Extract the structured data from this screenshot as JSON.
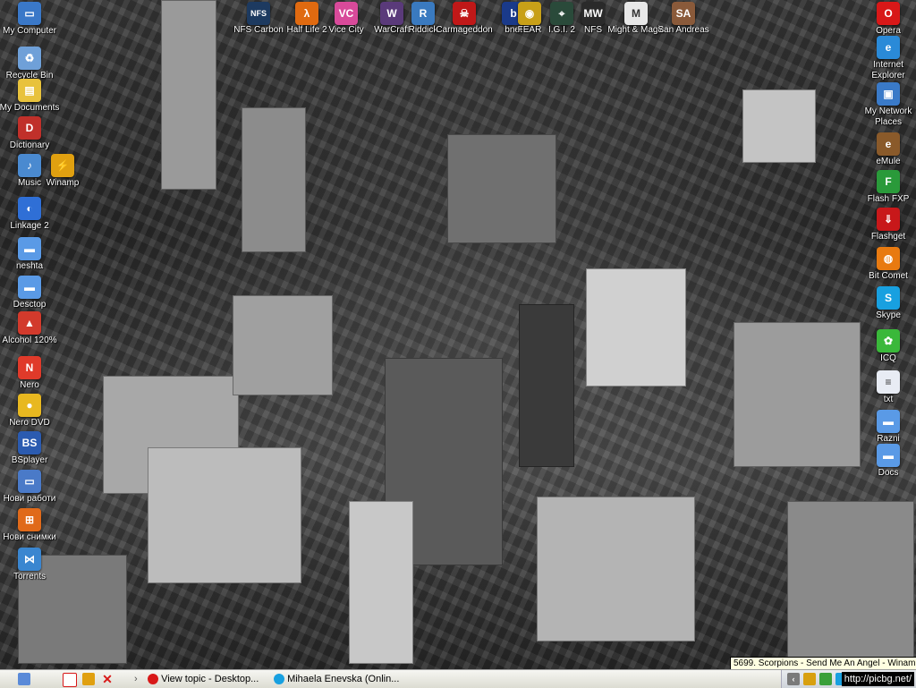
{
  "desktop": {
    "left_icons": [
      {
        "label": "My Computer",
        "icon": "computer-icon",
        "color": "#3a78c8",
        "glyph": "▭"
      },
      {
        "label": "Recycle Bin",
        "icon": "recycle-bin-icon",
        "color": "#6fa0d8",
        "glyph": "♻"
      },
      {
        "label": "My Documents",
        "icon": "documents-folder-icon",
        "color": "#e8c23c",
        "glyph": "▤"
      },
      {
        "label": "Dictionary",
        "icon": "dictionary-icon",
        "color": "#c0302a",
        "glyph": "D"
      },
      {
        "label": "Music",
        "icon": "music-icon",
        "color": "#4a8ad0",
        "glyph": "♪"
      },
      {
        "label": "Linkage 2",
        "icon": "linkage-icon",
        "color": "#2f6fd6",
        "glyph": "◐"
      },
      {
        "label": "neshta",
        "icon": "folder-icon",
        "color": "#5a9ae6",
        "glyph": "▬"
      },
      {
        "label": "Desctop",
        "icon": "folder-icon",
        "color": "#5a9ae6",
        "glyph": "▬"
      },
      {
        "label": "Alcohol 120%",
        "icon": "alcohol-icon",
        "color": "#d23a2c",
        "glyph": "▲"
      },
      {
        "label": "Nero",
        "icon": "nero-icon",
        "color": "#e03a2a",
        "glyph": "N"
      },
      {
        "label": "Nero DVD",
        "icon": "nero-dvd-icon",
        "color": "#e8b820",
        "glyph": "●"
      },
      {
        "label": "BSplayer",
        "icon": "bsplayer-icon",
        "color": "#2b5bb0",
        "glyph": "BS"
      },
      {
        "label": "Нови работи",
        "icon": "scanner-icon",
        "color": "#4a7ac8",
        "glyph": "▭"
      },
      {
        "label": "Нови снимки",
        "icon": "windows-flag-icon",
        "color": "#e06a1a",
        "glyph": "⊞"
      },
      {
        "label": "Torrents",
        "icon": "network-folder-icon",
        "color": "#3a86d0",
        "glyph": "⋈"
      }
    ],
    "winamp": {
      "label": "Winamp",
      "icon": "winamp-icon",
      "color": "#e0a010",
      "glyph": "⚡"
    },
    "top_icons": [
      {
        "label": "NFS Carbon",
        "icon": "nfs-carbon-icon",
        "color": "#1d3a60",
        "glyph": "NFS"
      },
      {
        "label": "Half Life 2",
        "icon": "half-life-icon",
        "color": "#e06a10",
        "glyph": "λ"
      },
      {
        "label": "Vice City",
        "icon": "vice-city-icon",
        "color": "#d84a9a",
        "glyph": "VC"
      },
      {
        "label": "WarCraft",
        "icon": "warcraft-icon",
        "color": "#5a3a7a",
        "glyph": "W"
      },
      {
        "label": "Riddick",
        "icon": "riddick-icon",
        "color": "#3a7ac0",
        "glyph": "R"
      },
      {
        "label": "Carmageddon",
        "icon": "carmageddon-icon",
        "color": "#c01818",
        "glyph": "☠"
      },
      {
        "label": "bnet",
        "icon": "bnet-icon",
        "color": "#1a3a8a",
        "glyph": "b"
      },
      {
        "label": "FEAR",
        "icon": "fear-icon",
        "color": "#c8a018",
        "glyph": "◉"
      },
      {
        "label": "I.G.I. 2",
        "icon": "igi-icon",
        "color": "#2a4a3a",
        "glyph": "⌖"
      },
      {
        "label": "NFS",
        "icon": "nfs-mw-icon",
        "color": "#2a2a2a",
        "glyph": "MW"
      },
      {
        "label": "Might & Magic",
        "icon": "might-magic-icon",
        "color": "#e8e8e8",
        "glyph": "M"
      },
      {
        "label": "San Andreas",
        "icon": "san-andreas-icon",
        "color": "#8a5a3a",
        "glyph": "SA"
      }
    ],
    "right_icons": [
      {
        "label": "Opera",
        "icon": "opera-icon",
        "color": "#d81818",
        "glyph": "O"
      },
      {
        "label": "Internet Explorer",
        "icon": "internet-explorer-icon",
        "color": "#2a8ad8",
        "glyph": "e"
      },
      {
        "label": "My Network Places",
        "icon": "network-places-icon",
        "color": "#3a7ac8",
        "glyph": "▣"
      },
      {
        "label": "eMule",
        "icon": "emule-icon",
        "color": "#8a5a2a",
        "glyph": "e"
      },
      {
        "label": "Flash FXP",
        "icon": "flashfxp-icon",
        "color": "#2a9a3a",
        "glyph": "F"
      },
      {
        "label": "Flashget",
        "icon": "flashget-icon",
        "color": "#c8181a",
        "glyph": "⇓"
      },
      {
        "label": "Bit Comet",
        "icon": "bitcomet-icon",
        "color": "#e87a10",
        "glyph": "◍"
      },
      {
        "label": "Skype",
        "icon": "skype-icon",
        "color": "#18a0e0",
        "glyph": "S"
      },
      {
        "label": "ICQ",
        "icon": "icq-icon",
        "color": "#3ab83a",
        "glyph": "✿"
      },
      {
        "label": "txt",
        "icon": "text-file-icon",
        "color": "#e8ecf4",
        "glyph": "≡"
      },
      {
        "label": "Razni",
        "icon": "folder-icon",
        "color": "#5a9ae6",
        "glyph": "▬"
      },
      {
        "label": "Docs",
        "icon": "folder-icon",
        "color": "#5a9ae6",
        "glyph": "▬"
      }
    ]
  },
  "tooltip": "5699. Scorpions - Send Me An Angel - Winamp",
  "taskbar": {
    "tasks": [
      {
        "label": "View topic - Desktop...",
        "icon": "opera-task-icon"
      },
      {
        "label": "Mihaela Enevska (Onlin...",
        "icon": "skype-task-icon"
      }
    ],
    "tray_text": "http://picbg.net/"
  }
}
